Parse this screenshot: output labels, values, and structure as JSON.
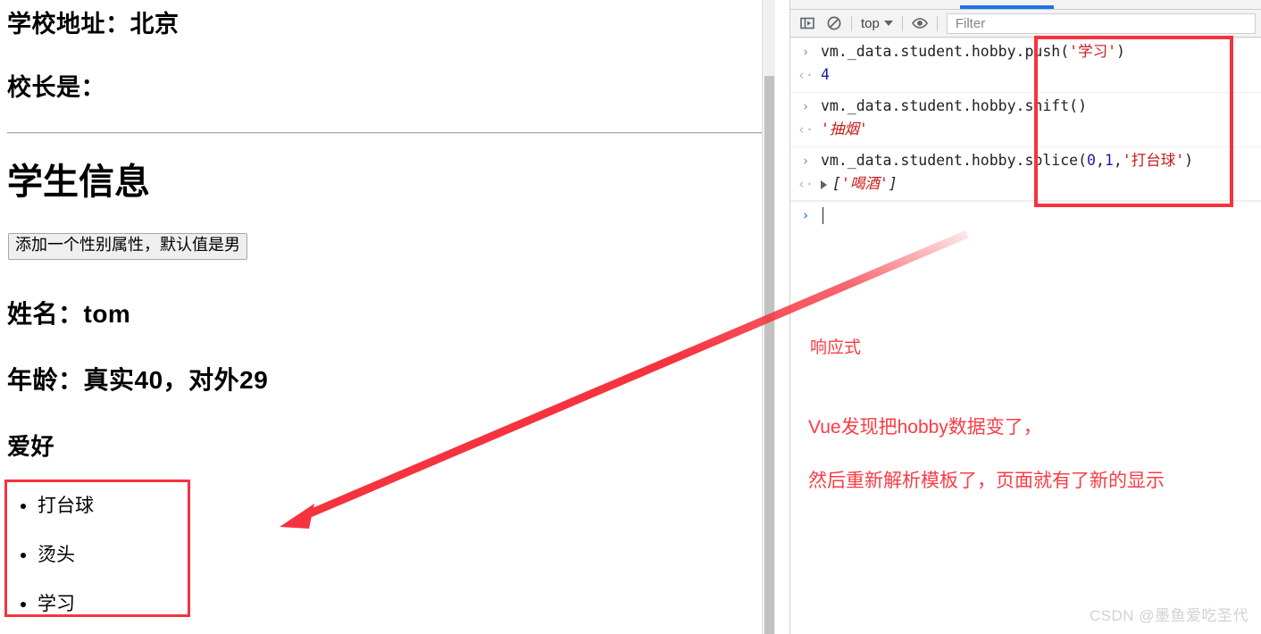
{
  "page": {
    "school_address": "学校地址：北京",
    "principal": "校长是：",
    "student_heading": "学生信息",
    "gender_button": "添加一个性别属性，默认值是男",
    "name_line": "姓名：tom",
    "age_line": "年龄：真实40，对外29",
    "hobby_heading": "爱好",
    "hobbies": [
      "打台球",
      "烫头",
      "学习"
    ]
  },
  "devtools": {
    "toolbar": {
      "sidebar_toggle_icon": "console-sidebar-icon",
      "clear_console_icon": "clear-console-icon",
      "context_label": "top",
      "caret_icon": "chevron-down-icon",
      "eye_icon": "live-expression-eye-icon",
      "filter_placeholder": "Filter",
      "filter_value": ""
    },
    "console": [
      {
        "kind": "input",
        "gutter": "›",
        "prefix": "vm._data.student.hobby.",
        "method": "push(",
        "args": [
          {
            "text": "'学习'",
            "type": "string"
          }
        ],
        "suffix": ")"
      },
      {
        "kind": "output",
        "gutter": "‹",
        "value": "4",
        "type": "number"
      },
      {
        "kind": "input",
        "gutter": "›",
        "prefix": "vm._data.student.hobby.",
        "method": "shift(",
        "args": [],
        "suffix": ")"
      },
      {
        "kind": "output",
        "gutter": "‹",
        "value": "'抽烟'",
        "type": "string"
      },
      {
        "kind": "input",
        "gutter": "›",
        "prefix": "vm._data.student.hobby.",
        "method": "splice(",
        "args": [
          {
            "text": "0",
            "type": "number"
          },
          {
            "text": ",",
            "type": "plain"
          },
          {
            "text": "1",
            "type": "number"
          },
          {
            "text": ",",
            "type": "plain"
          },
          {
            "text": "'打台球'",
            "type": "string"
          }
        ],
        "suffix": ")"
      },
      {
        "kind": "output",
        "gutter": "‹",
        "value": "[ '喝酒' ]",
        "type": "array",
        "expandable": true,
        "array_open": "[",
        "array_items": "'喝酒'",
        "array_close": "]"
      },
      {
        "kind": "prompt",
        "gutter": "›",
        "value": ""
      }
    ]
  },
  "annotations": {
    "label_reactive": "响应式",
    "explanation_line1": "Vue发现把hobby数据变了，",
    "explanation_line2": "然后重新解析模板了，页面就有了新的显示",
    "red_color": "#fa3c44",
    "box_color": "#f5333f"
  },
  "watermark": "CSDN @墨鱼爱吃圣代"
}
